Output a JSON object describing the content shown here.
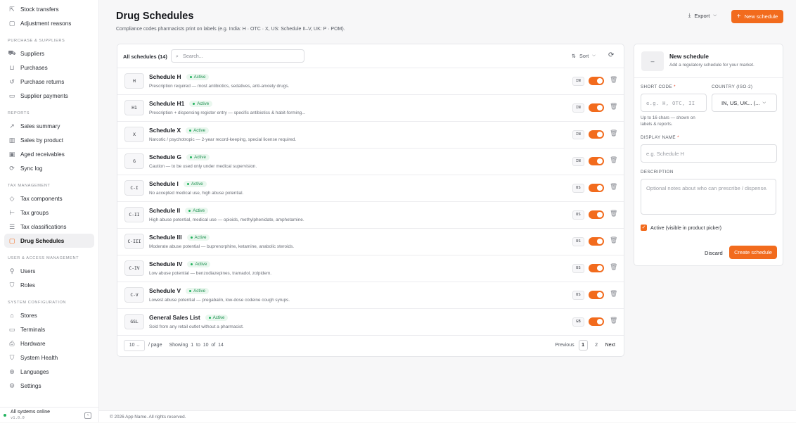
{
  "sidebar": {
    "top_items": [
      {
        "label": "Stock transfers",
        "icon": "external-link-icon"
      },
      {
        "label": "Adjustment reasons",
        "icon": "note-icon"
      }
    ],
    "sections": [
      {
        "title": "PURCHASE & SUPPLIERS",
        "items": [
          {
            "label": "Suppliers",
            "icon": "truck-icon"
          },
          {
            "label": "Purchases",
            "icon": "cart-icon"
          },
          {
            "label": "Purchase returns",
            "icon": "return-icon"
          },
          {
            "label": "Supplier payments",
            "icon": "card-icon"
          }
        ]
      },
      {
        "title": "REPORTS",
        "items": [
          {
            "label": "Sales summary",
            "icon": "trend-icon"
          },
          {
            "label": "Sales by product",
            "icon": "bar-chart-icon"
          },
          {
            "label": "Aged receivables",
            "icon": "receivables-icon"
          },
          {
            "label": "Sync log",
            "icon": "sync-icon"
          }
        ]
      },
      {
        "title": "TAX MANAGEMENT",
        "items": [
          {
            "label": "Tax components",
            "icon": "tag-icon"
          },
          {
            "label": "Tax groups",
            "icon": "list-tree-icon"
          },
          {
            "label": "Tax classifications",
            "icon": "list-icon"
          },
          {
            "label": "Drug Schedules",
            "icon": "note-icon",
            "active": true
          }
        ]
      },
      {
        "title": "USER & ACCESS MANAGEMENT",
        "items": [
          {
            "label": "Users",
            "icon": "user-icon"
          },
          {
            "label": "Roles",
            "icon": "shield-icon"
          }
        ]
      },
      {
        "title": "SYSTEM CONFIGURATION",
        "items": [
          {
            "label": "Stores",
            "icon": "store-icon"
          },
          {
            "label": "Terminals",
            "icon": "monitor-icon"
          },
          {
            "label": "Hardware",
            "icon": "printer-icon"
          },
          {
            "label": "System Health",
            "icon": "shield-icon"
          },
          {
            "label": "Languages",
            "icon": "globe-icon"
          },
          {
            "label": "Settings",
            "icon": "gear-icon"
          }
        ]
      }
    ],
    "footer": {
      "status": "All systems online",
      "version": "v1.0.0"
    }
  },
  "header": {
    "title": "Drug Schedules",
    "subtitle": "Compliance codes pharmacists print on labels (e.g. India: H · OTC · X, US: Schedule II–V, UK: P · POM).",
    "export_label": "Export",
    "new_label": "New schedule"
  },
  "list": {
    "count_label": "All schedules (14)",
    "search_placeholder": "Search...",
    "sort_label": "Sort",
    "rows": [
      {
        "code": "H",
        "name": "Schedule H",
        "status": "Active",
        "desc": "Prescription required — most antibiotics, sedatives, anti-anxiety drugs.",
        "country": "IN"
      },
      {
        "code": "H1",
        "name": "Schedule H1",
        "status": "Active",
        "desc": "Prescription + dispensing register entry — specific antibiotics & habit-forming...",
        "country": "IN"
      },
      {
        "code": "X",
        "name": "Schedule X",
        "status": "Active",
        "desc": "Narcotic / psychotropic — 2-year record-keeping, special license required.",
        "country": "IN"
      },
      {
        "code": "G",
        "name": "Schedule G",
        "status": "Active",
        "desc": "Caution — to be used only under medical supervision.",
        "country": "IN"
      },
      {
        "code": "C-I",
        "name": "Schedule I",
        "status": "Active",
        "desc": "No accepted medical use, high abuse potential.",
        "country": "US"
      },
      {
        "code": "C-II",
        "name": "Schedule II",
        "status": "Active",
        "desc": "High abuse potential, medical use — opioids, methylphenidate, amphetamine.",
        "country": "US"
      },
      {
        "code": "C-III",
        "name": "Schedule III",
        "status": "Active",
        "desc": "Moderate abuse potential — buprenorphine, ketamine, anabolic steroids.",
        "country": "US"
      },
      {
        "code": "C-IV",
        "name": "Schedule IV",
        "status": "Active",
        "desc": "Low abuse potential — benzodiazepines, tramadol, zolpidem.",
        "country": "US"
      },
      {
        "code": "C-V",
        "name": "Schedule V",
        "status": "Active",
        "desc": "Lowest abuse potential — pregabalin, low-dose codeine cough syrups.",
        "country": "US"
      },
      {
        "code": "GSL",
        "name": "General Sales List",
        "status": "Active",
        "desc": "Sold from any retail outlet without a pharmacist.",
        "country": "GB"
      }
    ],
    "footer": {
      "per_page": "10",
      "per_page_label": "/ page",
      "showing": "Showing  1  to  10  of  14",
      "previous": "Previous",
      "pages": [
        "1",
        "2"
      ],
      "next": "Next"
    }
  },
  "form": {
    "avatar": "–",
    "title": "New schedule",
    "subtitle": "Add a regulatory schedule for your market.",
    "short_code_label": "SHORT CODE",
    "short_code_placeholder": "e.g. H, OTC, II",
    "short_code_hint": "Up to 16 chars — shown on labels & reports.",
    "country_label": "COUNTRY (ISO-2)",
    "country_value": "IN, US, UK... (...",
    "display_name_label": "DISPLAY NAME",
    "display_name_placeholder": "e.g. Schedule H",
    "description_label": "DESCRIPTION",
    "description_placeholder": "Optional notes about who can prescribe / dispense.",
    "active_label": "Active (visible in product picker)",
    "discard_label": "Discard",
    "create_label": "Create schedule"
  },
  "page_footer": "© 2026 App Name. All rights reserved.",
  "colors": {
    "accent": "#f26b1d",
    "success": "#22b35e"
  }
}
